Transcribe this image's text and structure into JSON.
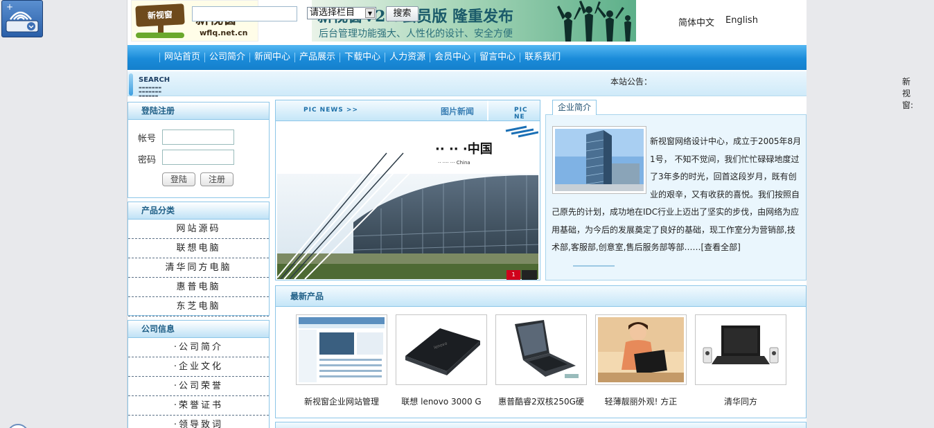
{
  "header": {
    "logo_sign": "新视窗",
    "logo_name": "新视窗",
    "logo_url": "wflq.net.cn",
    "banner_title": "新视窗V2.0会员版 隆重发布",
    "banner_subtitle": "后台管理功能强大、人性化的设计、安全方便",
    "lang_cn": "简体中文",
    "lang_en": "English"
  },
  "nav": [
    "网站首页",
    "公司简介",
    "新闻中心",
    "产品展示",
    "下载中心",
    "人力资源",
    "会员中心",
    "留言中心",
    "联系我们"
  ],
  "search": {
    "logo_title": "SEARCH",
    "select_value": "请选择栏目",
    "button": "搜索",
    "notice_label": "本站公告：",
    "notice_scroll": "新视窗:"
  },
  "login": {
    "title": "登陆注册",
    "account_label": "帐号",
    "password_label": "密码",
    "login_button": "登陆",
    "register_button": "注册"
  },
  "categories": {
    "title": "产品分类",
    "items": [
      "网站源码",
      "联想电脑",
      "清华同方电脑",
      "惠普电脑",
      "东芝电脑"
    ]
  },
  "company_info": {
    "title": "公司信息",
    "items": [
      "·公司简介",
      "·企业文化",
      "·公司荣誉",
      "·荣誉证书",
      "·领导致词"
    ]
  },
  "pic_news": {
    "en_label": "PIC NEWS >>",
    "cn_label": "图片新闻",
    "en_label2": "PIC NE",
    "page_number": "1"
  },
  "intro": {
    "tab": "企业简介",
    "text": "新视窗网络设计中心，成立于2005年8月1号， 不知不觉间，我们忙忙碌碌地度过了3年多的时光，回首这段岁月，既有创业的艰辛，又有收获的喜悦。我们按照自己原先的计划，成功地在IDC行业上迈出了坚实的步伐，由网络为应用基础，为今后的发展奠定了良好的基础，现工作室分为营销部,技术部,客服部,创意室,售后服务部等部……[查看全部]"
  },
  "products": {
    "title": "最新产品",
    "items": [
      {
        "name": "新视窗企业网站管理"
      },
      {
        "name": "联想 lenovo 3000 G"
      },
      {
        "name": "惠普酷睿2双核250G硬"
      },
      {
        "name": "轻薄靓丽外观! 方正"
      },
      {
        "name": "清华同方"
      }
    ]
  }
}
